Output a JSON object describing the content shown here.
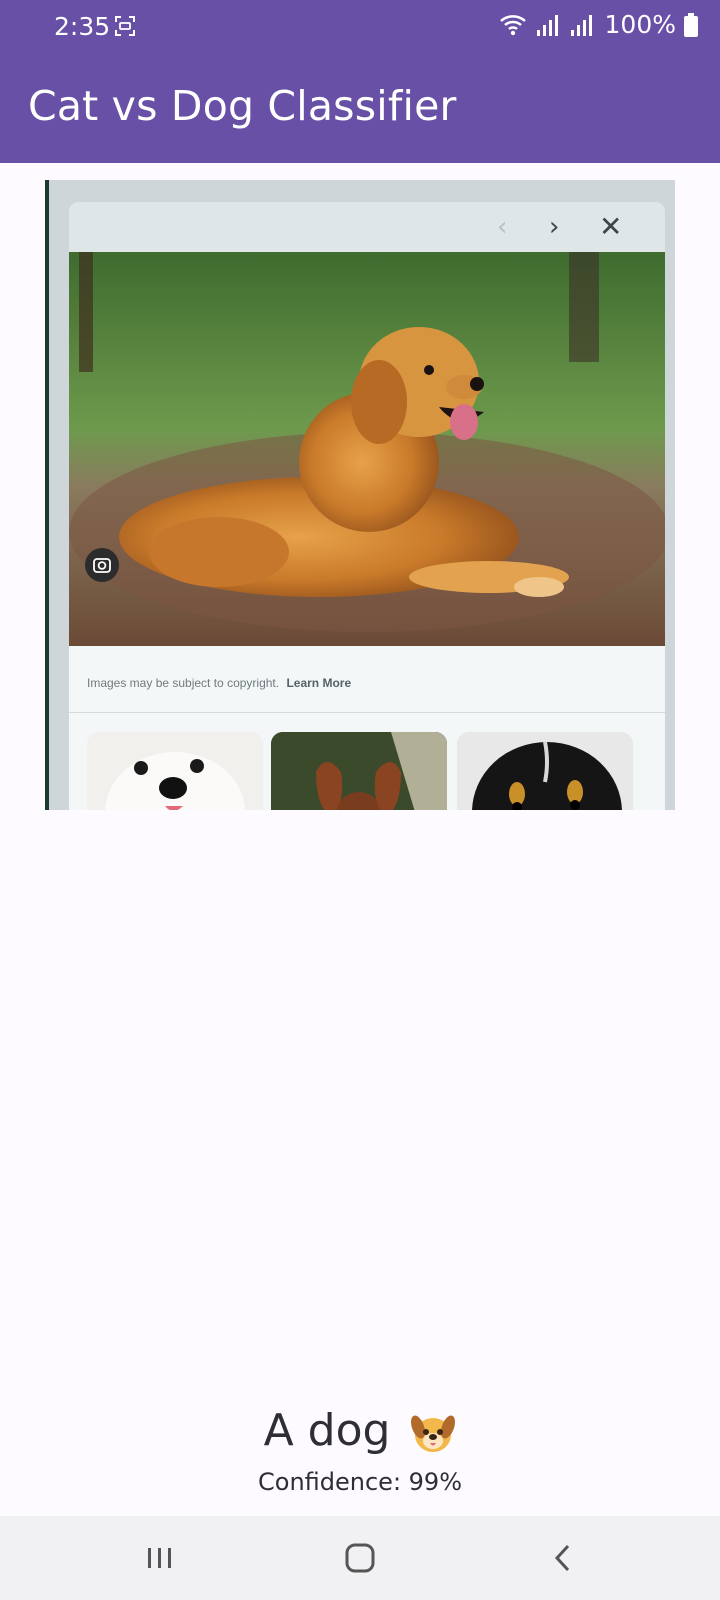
{
  "status_bar": {
    "time": "2:35",
    "battery": "100%",
    "icons": [
      "screenshot-icon",
      "wifi-icon",
      "signal-icon",
      "signal-icon",
      "battery-icon"
    ]
  },
  "app_bar": {
    "title": "Cat vs Dog Classifier",
    "color": "#6750a6"
  },
  "preview": {
    "caption": "Images may be subject to copyright.",
    "learn_more": "Learn More",
    "icons": [
      "chevron-left-icon",
      "chevron-right-icon",
      "close-icon",
      "lens-icon"
    ]
  },
  "result": {
    "label": "A dog",
    "emoji": "dog-face-icon",
    "confidence": "Confidence: 99%"
  },
  "navigation_bar": {
    "buttons": [
      "recents-icon",
      "home-icon",
      "back-icon"
    ]
  }
}
